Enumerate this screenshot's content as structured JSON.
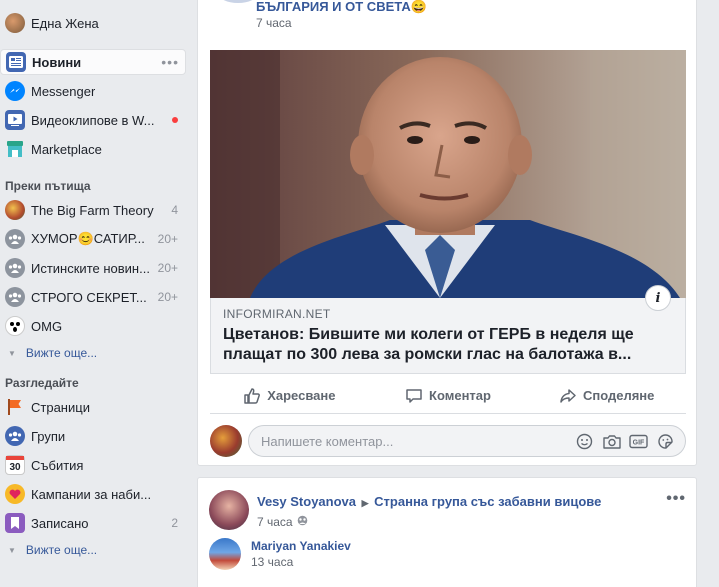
{
  "sidebar": {
    "profile": {
      "name": "Една Жена"
    },
    "main_items": [
      {
        "label": "Новини",
        "icon": "news-feed-icon",
        "active": true,
        "more": "•••"
      },
      {
        "label": "Messenger",
        "icon": "messenger-icon"
      },
      {
        "label": "Видеоклипове в W...",
        "icon": "watch-icon",
        "badge": "dot"
      },
      {
        "label": "Marketplace",
        "icon": "marketplace-icon"
      }
    ],
    "shortcuts_header": "Преки пътища",
    "shortcuts": [
      {
        "label": "The Big Farm Theory",
        "count": "4"
      },
      {
        "label": "ХУМОР😊САТИР...",
        "count": "20+"
      },
      {
        "label": "Истинските новин...",
        "count": "20+"
      },
      {
        "label": "СТРОГО СЕКРЕТ...",
        "count": "20+"
      },
      {
        "label": "OMG",
        "count": ""
      }
    ],
    "see_more_1": "Вижте още...",
    "explore_header": "Разгледайте",
    "explore": [
      {
        "label": "Страници",
        "icon": "pages-flag-icon",
        "count": ""
      },
      {
        "label": "Групи",
        "icon": "groups-icon",
        "count": ""
      },
      {
        "label": "Събития",
        "icon": "events-calendar-icon",
        "count": ""
      },
      {
        "label": "Кампании за наби...",
        "icon": "fundraisers-icon",
        "count": ""
      },
      {
        "label": "Записано",
        "icon": "saved-icon",
        "count": "2"
      }
    ],
    "see_more_2": "Вижте още..."
  },
  "post1": {
    "title_tail": "БЪЛГАРИЯ И ОТ СВЕТА😄",
    "time": "7 часа",
    "link": {
      "domain": "INFORMIRAN.NET",
      "title": "Цветанов: Бившите ми колеги от ГЕРБ в неделя ще плащат по 300 лева за ромски глас на балотажа в..."
    },
    "actions": {
      "like": "Харесване",
      "comment": "Коментар",
      "share": "Споделяне"
    },
    "comment_placeholder": "Напишете коментар..."
  },
  "post2": {
    "author": "Vesy Stoyanova",
    "separator": "▶",
    "group": "Странна група със забавни вицове",
    "time": "7 часа",
    "more": "•••",
    "comment_author": "Mariyan Yanakiev",
    "comment_time": "13 часа"
  },
  "colors": {
    "link": "#365899",
    "accent": "#4267b2",
    "background": "#e9ebee"
  }
}
